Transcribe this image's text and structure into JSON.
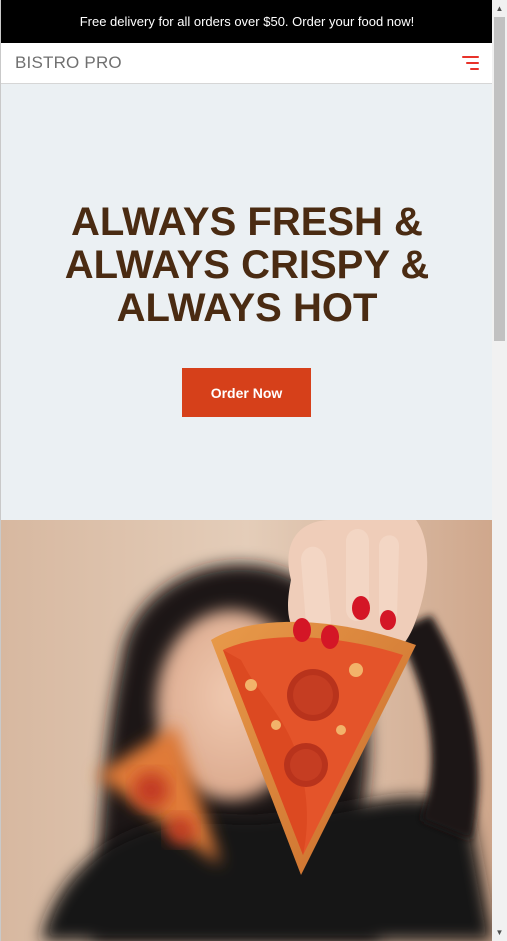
{
  "promo": {
    "text": "Free delivery for all orders over $50. Order your food now!"
  },
  "header": {
    "brand": "BISTRO PRO",
    "menu_icon": "hamburger-menu-icon"
  },
  "hero": {
    "title_lines": [
      "ALWAYS FRESH &",
      "ALWAYS CRISPY &",
      "ALWAYS HOT"
    ],
    "cta_label": "Order Now"
  },
  "photo": {
    "subject": "pizza-slice-image"
  },
  "colors": {
    "promo_bg": "#000000",
    "hero_bg": "#ebf0f3",
    "title": "#4a2b12",
    "cta_bg": "#d6401a",
    "menu_icon": "#e8322a"
  }
}
